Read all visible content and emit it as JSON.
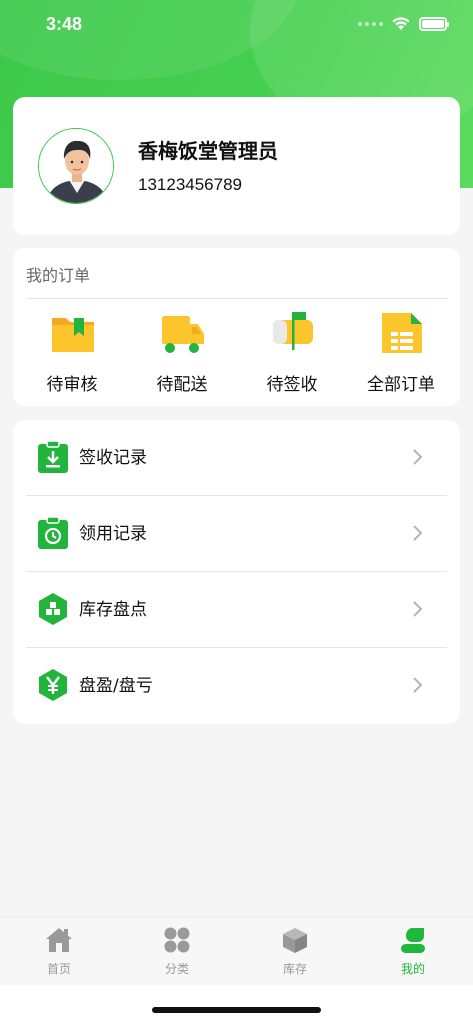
{
  "status_bar": {
    "time": "3:48"
  },
  "profile": {
    "name": "香梅饭堂管理员",
    "phone": "13123456789"
  },
  "orders": {
    "title": "我的订单",
    "items": [
      {
        "label": "待审核",
        "icon": "folder-bookmark-icon"
      },
      {
        "label": "待配送",
        "icon": "delivery-truck-icon"
      },
      {
        "label": "待签收",
        "icon": "mailbox-icon"
      },
      {
        "label": "全部订单",
        "icon": "document-list-icon"
      }
    ]
  },
  "menu": {
    "items": [
      {
        "label": "签收记录",
        "icon": "clipboard-download-icon"
      },
      {
        "label": "领用记录",
        "icon": "clipboard-clock-icon"
      },
      {
        "label": "库存盘点",
        "icon": "hexagon-blocks-icon"
      },
      {
        "label": "盘盈/盘亏",
        "icon": "hexagon-yen-icon"
      }
    ]
  },
  "tabbar": {
    "items": [
      {
        "label": "首页",
        "icon": "home-icon",
        "active": false
      },
      {
        "label": "分类",
        "icon": "grid-dots-icon",
        "active": false
      },
      {
        "label": "库存",
        "icon": "box-icon",
        "active": false
      },
      {
        "label": "我的",
        "icon": "user-icon",
        "active": true
      }
    ]
  },
  "colors": {
    "brand_green": "#3cc84a",
    "icon_yellow": "#fcc52c",
    "active_tab": "#1fb83a",
    "inactive_tab": "#999999"
  }
}
